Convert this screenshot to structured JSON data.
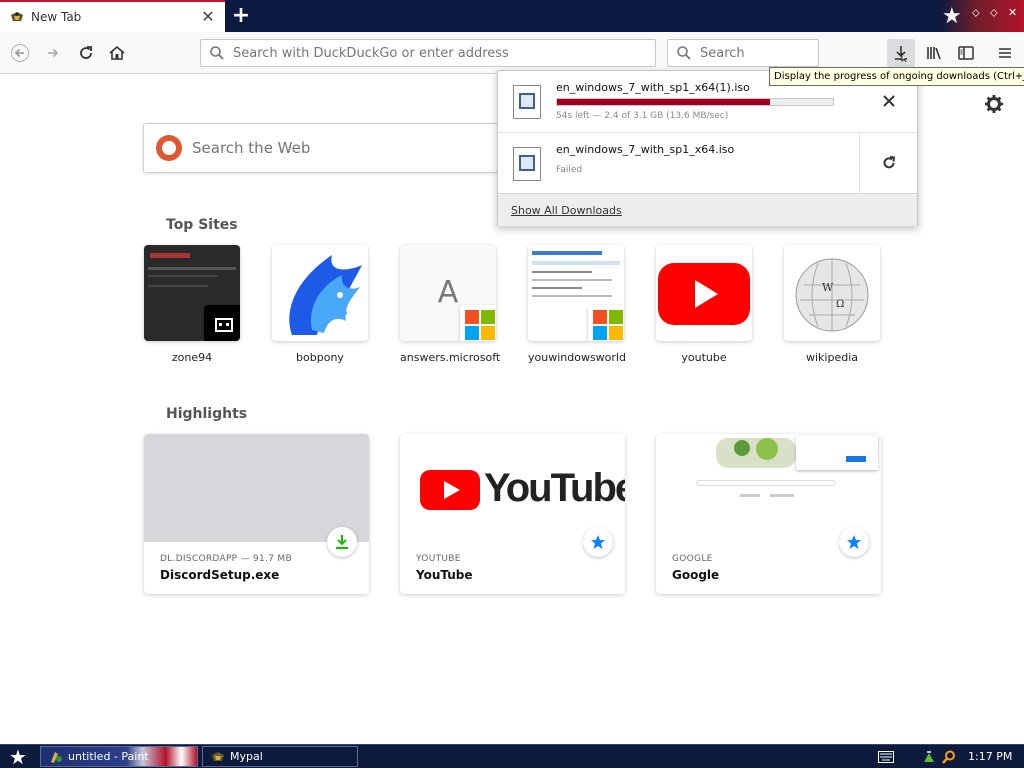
{
  "tab": {
    "title": "New Tab"
  },
  "nav": {
    "url_placeholder": "Search with DuckDuckGo or enter address",
    "search_placeholder": "Search"
  },
  "tooltip": "Display the progress of ongoing downloads (Ctrl+J)",
  "websearch": {
    "placeholder": "Search the Web"
  },
  "top_sites": {
    "title": "Top Sites",
    "items": [
      {
        "label": "zone94"
      },
      {
        "label": "bobpony"
      },
      {
        "label": "answers.microsoft",
        "letter": "A"
      },
      {
        "label": "youwindowsworld"
      },
      {
        "label": "youtube"
      },
      {
        "label": "wikipedia"
      }
    ]
  },
  "highlights": {
    "title": "Highlights",
    "items": [
      {
        "meta": "DL.DISCORDAPP — 91.7 MB",
        "title": "DiscordSetup.exe"
      },
      {
        "meta": "YOUTUBE",
        "title": "YouTube",
        "logo_text": "YouTube"
      },
      {
        "meta": "GOOGLE",
        "title": "Google"
      }
    ]
  },
  "downloads": {
    "items": [
      {
        "filename": "en_windows_7_with_sp1_x64(1).iso",
        "status": "54s left — 2.4 of 3.1 GB (13.6 MB/sec)",
        "progress": 0.77
      },
      {
        "filename": "en_windows_7_with_sp1_x64.iso",
        "status": "Failed"
      }
    ],
    "show_all": "Show All Downloads"
  },
  "taskbar": {
    "items": [
      {
        "label": "untitled - Paint"
      },
      {
        "label": "Mypal"
      }
    ],
    "clock": "1:17 PM"
  },
  "colors": {
    "accent": "#a4001d",
    "youtube": "#ff0000",
    "taskbar": "#0c1a3c"
  }
}
